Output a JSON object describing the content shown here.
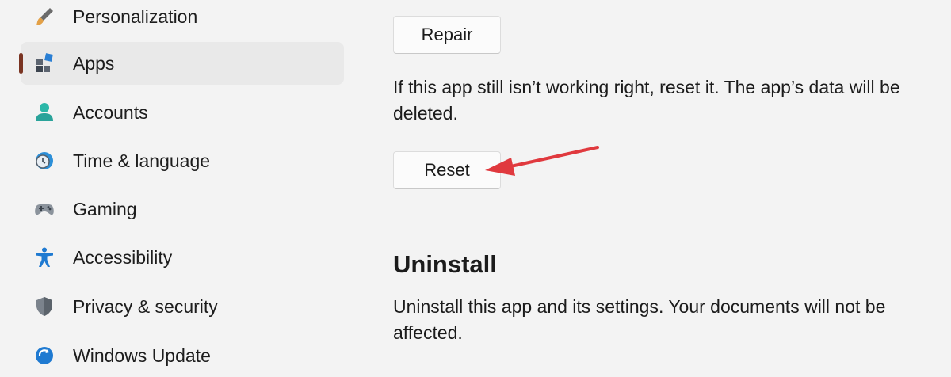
{
  "sidebar": {
    "items": [
      {
        "label": "Personalization",
        "icon": "paintbrush-icon"
      },
      {
        "label": "Apps",
        "icon": "apps-icon",
        "selected": true
      },
      {
        "label": "Accounts",
        "icon": "person-icon"
      },
      {
        "label": "Time & language",
        "icon": "globe-clock-icon"
      },
      {
        "label": "Gaming",
        "icon": "gamepad-icon"
      },
      {
        "label": "Accessibility",
        "icon": "accessibility-icon"
      },
      {
        "label": "Privacy & security",
        "icon": "shield-icon"
      },
      {
        "label": "Windows Update",
        "icon": "update-icon"
      }
    ]
  },
  "main": {
    "repair_button": "Repair",
    "reset_description": "If this app still isn’t working right, reset it. The app’s data will be deleted.",
    "reset_button": "Reset",
    "uninstall_title": "Uninstall",
    "uninstall_description": "Uninstall this app and its settings. Your documents will not be affected."
  },
  "colors": {
    "accent": "#7a3422",
    "annotation_arrow": "#e0393e",
    "background": "#f3f3f3",
    "selected_bg": "#e9e9e9"
  }
}
